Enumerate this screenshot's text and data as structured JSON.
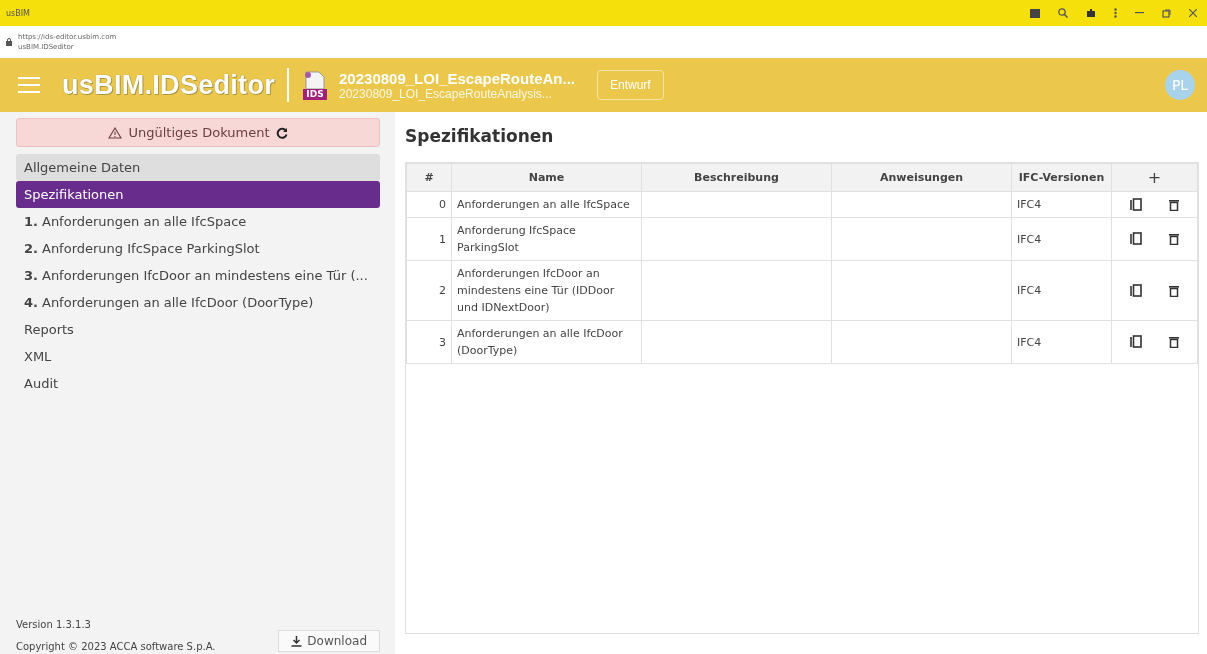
{
  "browser": {
    "title": "usBIM",
    "url": "https://ids-editor.usbim.com",
    "page_title": "usBIM.IDSeditor"
  },
  "header": {
    "logo": "usBIM.IDSeditor",
    "file_badge": "IDS",
    "file_title": "20230809_LOI_EscapeRouteAn...",
    "file_subtitle": "20230809_LOI_EscapeRouteAnalysis...",
    "status_button": "Entwurf",
    "avatar": "PL"
  },
  "sidebar": {
    "alert": "Ungültiges Dokument",
    "items": [
      {
        "label": "Allgemeine Daten",
        "kind": "section",
        "selected": false,
        "shaded": true
      },
      {
        "label": "Spezifikationen",
        "kind": "section",
        "selected": true,
        "shaded": false
      },
      {
        "number": "1.",
        "label": "Anforderungen an alle IfcSpace",
        "kind": "spec",
        "selected": false,
        "shaded": false
      },
      {
        "number": "2.",
        "label": "Anforderung IfcSpace ParkingSlot",
        "kind": "spec",
        "selected": false,
        "shaded": false
      },
      {
        "number": "3.",
        "label": "Anforderungen IfcDoor an mindestens eine Tür (...",
        "kind": "spec",
        "selected": false,
        "shaded": false
      },
      {
        "number": "4.",
        "label": "Anforderungen an alle IfcDoor (DoorType)",
        "kind": "spec",
        "selected": false,
        "shaded": false
      },
      {
        "label": "Reports",
        "kind": "section",
        "selected": false,
        "shaded": false
      },
      {
        "label": "XML",
        "kind": "section",
        "selected": false,
        "shaded": false
      },
      {
        "label": "Audit",
        "kind": "section",
        "selected": false,
        "shaded": false
      }
    ],
    "version": "Version 1.3.1.3",
    "copyright": "Copyright © 2023 ACCA software S.p.A.",
    "download_button": "Download"
  },
  "main": {
    "title": "Spezifikationen",
    "table": {
      "columns": [
        "#",
        "Name",
        "Beschreibung",
        "Anweisungen",
        "IFC-Versionen",
        "+"
      ],
      "rows": [
        {
          "index": "0",
          "name": "Anforderungen an alle IfcSpace",
          "description": "",
          "instructions": "",
          "ifc_versions": "IFC4"
        },
        {
          "index": "1",
          "name": "Anforderung IfcSpace ParkingSlot",
          "description": "",
          "instructions": "",
          "ifc_versions": "IFC4"
        },
        {
          "index": "2",
          "name": "Anforderungen IfcDoor an mindestens eine Tür (IDDoor und IDNextDoor)",
          "description": "",
          "instructions": "",
          "ifc_versions": "IFC4"
        },
        {
          "index": "3",
          "name": "Anforderungen an alle IfcDoor (DoorType)",
          "description": "",
          "instructions": "",
          "ifc_versions": "IFC4"
        }
      ]
    }
  }
}
